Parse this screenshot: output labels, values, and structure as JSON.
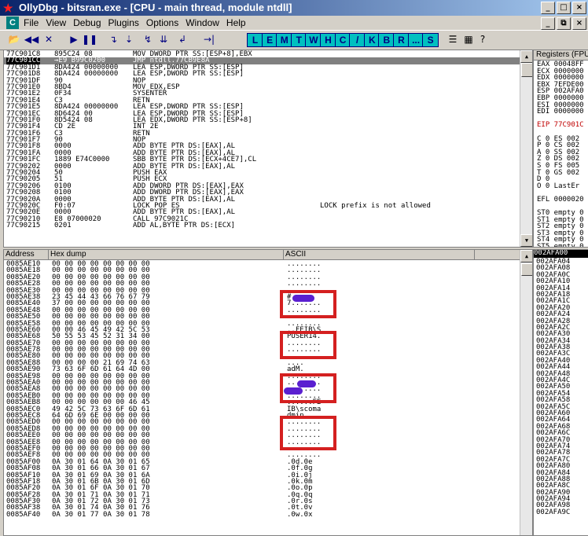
{
  "window": {
    "title": "OllyDbg - bitsran.exe - [CPU - main thread, module ntdll]",
    "min_glyph": "_",
    "max_glyph": "□",
    "close_glyph": "×"
  },
  "menu": {
    "logo": "C",
    "items": [
      "File",
      "View",
      "Debug",
      "Plugins",
      "Options",
      "Window",
      "Help"
    ],
    "right_buttons": [
      "_",
      "⧉",
      "×"
    ]
  },
  "toolbar": {
    "left_icons": [
      {
        "name": "open-icon",
        "glyph": "📂"
      },
      {
        "name": "rewind-icon",
        "glyph": "◀◀"
      },
      {
        "name": "close-icon",
        "glyph": "✕"
      },
      {
        "name": "run-icon",
        "glyph": "▶"
      },
      {
        "name": "pause-icon",
        "glyph": "❚❚"
      },
      {
        "name": "step-into-icon",
        "glyph": "↴"
      },
      {
        "name": "step-over-icon",
        "glyph": "⇣"
      },
      {
        "name": "trace-into-icon",
        "glyph": "↯"
      },
      {
        "name": "trace-over-icon",
        "glyph": "⇊"
      },
      {
        "name": "execute-till-return-icon",
        "glyph": "↲"
      },
      {
        "name": "goto-icon",
        "glyph": "→|"
      }
    ],
    "letters": [
      "L",
      "E",
      "M",
      "T",
      "W",
      "H",
      "C",
      "/",
      "K",
      "B",
      "R",
      "...",
      "S"
    ],
    "right_icons": [
      {
        "name": "list-icon",
        "glyph": "☰"
      },
      {
        "name": "grid-icon",
        "glyph": "▦"
      },
      {
        "name": "help-icon",
        "glyph": "?"
      }
    ]
  },
  "disasm": {
    "rows": [
      {
        "addr": "77C901C8",
        "hex": "895C24 08",
        "asm": "MOV DWORD PTR SS:[ESP+8],EBX",
        "comment": ""
      },
      {
        "addr": "77C901CC",
        "hex": "→E9 B99C0200",
        "asm": "JMP ntdll.77CB9E8A",
        "comment": "",
        "selected": true
      },
      {
        "addr": "77C901D1",
        "hex": "8DA424 00000000",
        "asm": "LEA ESP,DWORD PTR SS:[ESP]",
        "comment": ""
      },
      {
        "addr": "77C901D8",
        "hex": "8DA424 00000000",
        "asm": "LEA ESP,DWORD PTR SS:[ESP]",
        "comment": ""
      },
      {
        "addr": "77C901DF",
        "hex": "90",
        "asm": "NOP",
        "comment": ""
      },
      {
        "addr": "77C901E0",
        "hex": "8BD4",
        "asm": "MOV EDX,ESP",
        "comment": ""
      },
      {
        "addr": "77C901E2",
        "hex": "0F34",
        "asm": "SYSENTER",
        "comment": ""
      },
      {
        "addr": "77C901E4",
        "hex": "C3",
        "asm": "RETN",
        "comment": ""
      },
      {
        "addr": "77C901E5",
        "hex": "8DA424 00000000",
        "asm": "LEA ESP,DWORD PTR SS:[ESP]",
        "comment": ""
      },
      {
        "addr": "77C901EC",
        "hex": "8D6424 00",
        "asm": "LEA ESP,DWORD PTR SS:[ESP]",
        "comment": ""
      },
      {
        "addr": "77C901F0",
        "hex": "8D5424 08",
        "asm": "LEA EDX,DWORD PTR SS:[ESP+8]",
        "comment": ""
      },
      {
        "addr": "77C901F4",
        "hex": "CD 2E",
        "asm": "INT 2E",
        "comment": ""
      },
      {
        "addr": "77C901F6",
        "hex": "C3",
        "asm": "RETN",
        "comment": ""
      },
      {
        "addr": "77C901F7",
        "hex": "90",
        "asm": "NOP",
        "comment": ""
      },
      {
        "addr": "77C901F8",
        "hex": "0000",
        "asm": "ADD BYTE PTR DS:[EAX],AL",
        "comment": ""
      },
      {
        "addr": "77C901FA",
        "hex": "0000",
        "asm": "ADD BYTE PTR DS:[EAX],AL",
        "comment": ""
      },
      {
        "addr": "77C901FC",
        "hex": "1889 E74C0000",
        "asm": "SBB BYTE PTR DS:[ECX+4CE7],CL",
        "comment": ""
      },
      {
        "addr": "77C90202",
        "hex": "0000",
        "asm": "ADD BYTE PTR DS:[EAX],AL",
        "comment": ""
      },
      {
        "addr": "77C90204",
        "hex": "50",
        "asm": "PUSH EAX",
        "comment": ""
      },
      {
        "addr": "77C90205",
        "hex": "51",
        "asm": "PUSH ECX",
        "comment": ""
      },
      {
        "addr": "77C90206",
        "hex": "0100",
        "asm": "ADD DWORD PTR DS:[EAX],EAX",
        "comment": ""
      },
      {
        "addr": "77C90208",
        "hex": "0100",
        "asm": "ADD DWORD PTR DS:[EAX],EAX",
        "comment": ""
      },
      {
        "addr": "77C9020A",
        "hex": "0000",
        "asm": "ADD BYTE PTR DS:[EAX],AL",
        "comment": ""
      },
      {
        "addr": "77C9020C",
        "hex": "F0:07",
        "asm": "LOCK POP ES",
        "comment": "LOCK prefix is not allowed"
      },
      {
        "addr": "77C9020E",
        "hex": "0000",
        "asm": "ADD BYTE PTR DS:[EAX],AL",
        "comment": ""
      },
      {
        "addr": "77C90210",
        "hex": "E8 07000020",
        "asm": "CALL 97C9021C",
        "comment": ""
      },
      {
        "addr": "77C90215",
        "hex": "0201",
        "asm": "ADD AL,BYTE PTR DS:[ECX]",
        "comment": ""
      }
    ]
  },
  "registers": {
    "header": "Registers (FPU)",
    "lines": [
      {
        "text": "EAX 00048FF",
        "red": false
      },
      {
        "text": "ECX 0000000",
        "red": false
      },
      {
        "text": "EDX 0000000",
        "red": false
      },
      {
        "text": "EBX 7EFDE00",
        "red": false
      },
      {
        "text": "ESP 002AFA0",
        "red": false
      },
      {
        "text": "EBP 0000000",
        "red": false
      },
      {
        "text": "ESI 0000000",
        "red": false
      },
      {
        "text": "EDI 0000000",
        "red": false
      },
      {
        "text": "",
        "red": false
      },
      {
        "text": "EIP 77C901C",
        "red": true
      },
      {
        "text": "",
        "red": false
      },
      {
        "text": "C 0  ES 002",
        "red": false
      },
      {
        "text": "P 0  CS 002",
        "red": false
      },
      {
        "text": "A 0  SS 002",
        "red": false
      },
      {
        "text": "Z 0  DS 002",
        "red": false
      },
      {
        "text": "S 0  FS 005",
        "red": false
      },
      {
        "text": "T 0  GS 002",
        "red": false
      },
      {
        "text": "D 0",
        "red": false
      },
      {
        "text": "O 0  LastEr",
        "red": false
      },
      {
        "text": "",
        "red": false
      },
      {
        "text": "EFL 0000020",
        "red": false
      },
      {
        "text": "",
        "red": false
      },
      {
        "text": "ST0 empty 0",
        "red": false
      },
      {
        "text": "ST1 empty 0",
        "red": false
      },
      {
        "text": "ST2 empty 0",
        "red": false
      },
      {
        "text": "ST3 empty 0",
        "red": false
      },
      {
        "text": "ST4 empty 0",
        "red": false
      },
      {
        "text": "ST5 empty 0",
        "red": false
      }
    ]
  },
  "dump": {
    "headers": {
      "address": "Address",
      "hex": "Hex dump",
      "ascii": "ASCII"
    },
    "rows": [
      {
        "addr": "0085AE10",
        "hex": "00 00 00 00 00 00 00 00",
        "ascii": "........"
      },
      {
        "addr": "0085AE18",
        "hex": "00 00 00 00 00 00 00 00",
        "ascii": "........"
      },
      {
        "addr": "0085AE20",
        "hex": "00 00 00 00 00 00 00 00",
        "ascii": "........"
      },
      {
        "addr": "0085AE28",
        "hex": "00 00 00 00 00 00 00 00",
        "ascii": "........"
      },
      {
        "addr": "0085AE30",
        "hex": "00 00 00 00 00 00 00 00",
        "ascii": "........"
      },
      {
        "addr": "0085AE38",
        "hex": "23 45 44 43 66 76 67 79",
        "ascii": "#    gy"
      },
      {
        "addr": "0085AE40",
        "hex": "37 00 00 00 00 00 00 00",
        "ascii": "7......."
      },
      {
        "addr": "0085AE48",
        "hex": "00 00 00 00 00 00 00 00",
        "ascii": "........"
      },
      {
        "addr": "0085AE50",
        "hex": "00 00 00 00 00 00 00 00",
        "ascii": "........"
      },
      {
        "addr": "0085AE58",
        "hex": "00 00 00 00 00 00 00 00",
        "ascii": "........"
      },
      {
        "addr": "0085AE60",
        "hex": "00 00 46 45 49 42 5C 53",
        "ascii": "..FEIB\\S"
      },
      {
        "addr": "0085AE68",
        "hex": "50 55 53 45 52 31 34 00",
        "ascii": "PUSER14."
      },
      {
        "addr": "0085AE70",
        "hex": "00 00 00 00 00 00 00 00",
        "ascii": "........"
      },
      {
        "addr": "0085AE78",
        "hex": "00 00 00 00 00 00 00 00",
        "ascii": "........"
      },
      {
        "addr": "0085AE80",
        "hex": "00 00 00 00 00 00 00 00",
        "ascii": "........"
      },
      {
        "addr": "0085AE88",
        "hex": "00 00 00 00 21 69 74 63",
        "ascii": "....    "
      },
      {
        "addr": "0085AE90",
        "hex": "73 63 6F 6D 61 64 4D 00",
        "ascii": "    adM."
      },
      {
        "addr": "0085AE98",
        "hex": "00 00 00 00 00 00 00 00",
        "ascii": "........"
      },
      {
        "addr": "0085AEA0",
        "hex": "00 00 00 00 00 00 00 00",
        "ascii": "........"
      },
      {
        "addr": "0085AEA8",
        "hex": "00 00 00 00 00 00 00 00",
        "ascii": "........"
      },
      {
        "addr": "0085AEB0",
        "hex": "00 00 00 00 00 00 00 00",
        "ascii": "........"
      },
      {
        "addr": "0085AEB8",
        "hex": "00 00 00 00 00 00 46 45",
        "ascii": "......FE"
      },
      {
        "addr": "0085AEC0",
        "hex": "49 42 5C 73 63 6F 6D 61",
        "ascii": "IB\\scoma"
      },
      {
        "addr": "0085AEC8",
        "hex": "64 6D 69 6E 00 00 00 00",
        "ascii": "dmin...."
      },
      {
        "addr": "0085AED0",
        "hex": "00 00 00 00 00 00 00 00",
        "ascii": "........"
      },
      {
        "addr": "0085AED8",
        "hex": "00 00 00 00 00 00 00 00",
        "ascii": "........"
      },
      {
        "addr": "0085AEE0",
        "hex": "00 00 00 00 00 00 00 00",
        "ascii": "........"
      },
      {
        "addr": "0085AEE8",
        "hex": "00 00 00 00 00 00 00 00",
        "ascii": "........"
      },
      {
        "addr": "0085AEF0",
        "hex": "00 00 00 00 00 00 00 00",
        "ascii": "........"
      },
      {
        "addr": "0085AEF8",
        "hex": "00 00 00 00 00 00 00 00",
        "ascii": "........"
      },
      {
        "addr": "0085AF00",
        "hex": "0A 30 01 64 0A 30 01 65",
        "ascii": ".0d.0e"
      },
      {
        "addr": "0085AF08",
        "hex": "0A 30 01 66 0A 30 01 67",
        "ascii": ".0f.0g"
      },
      {
        "addr": "0085AF10",
        "hex": "0A 30 01 69 0A 30 01 6A",
        "ascii": ".0i.0j"
      },
      {
        "addr": "0085AF18",
        "hex": "0A 30 01 6B 0A 30 01 6D",
        "ascii": ".0k.0m"
      },
      {
        "addr": "0085AF20",
        "hex": "0A 30 01 6F 0A 30 01 70",
        "ascii": ".0o.0p"
      },
      {
        "addr": "0085AF28",
        "hex": "0A 30 01 71 0A 30 01 71",
        "ascii": ".0q.0q"
      },
      {
        "addr": "0085AF30",
        "hex": "0A 30 01 72 0A 30 01 73",
        "ascii": ".0r.0s"
      },
      {
        "addr": "0085AF38",
        "hex": "0A 30 01 74 0A 30 01 76",
        "ascii": ".0t.0v"
      },
      {
        "addr": "0085AF40",
        "hex": "0A 30 01 77 0A 30 01 78",
        "ascii": ".0w.0x"
      }
    ]
  },
  "stack": {
    "header": "002AFA00",
    "rows": [
      "002AFA04",
      "002AFA08",
      "002AFA0C",
      "002AFA10",
      "002AFA14",
      "002AFA18",
      "002AFA1C",
      "002AFA20",
      "002AFA24",
      "002AFA28",
      "002AFA2C",
      "002AFA30",
      "002AFA34",
      "002AFA38",
      "002AFA3C",
      "002AFA40",
      "002AFA44",
      "002AFA48",
      "002AFA4C",
      "002AFA50",
      "002AFA54",
      "002AFA58",
      "002AFA5C",
      "002AFA60",
      "002AFA64",
      "002AFA68",
      "002AFA6C",
      "002AFA70",
      "002AFA74",
      "002AFA78",
      "002AFA7C",
      "002AFA80",
      "002AFA84",
      "002AFA88",
      "002AFA8C",
      "002AFA90",
      "002AFA94",
      "002AFA98",
      "002AFA9C"
    ]
  },
  "colors": {
    "highlight_box": "#d42020",
    "redaction": "#5a1fd0",
    "title_start": "#0a246a"
  }
}
